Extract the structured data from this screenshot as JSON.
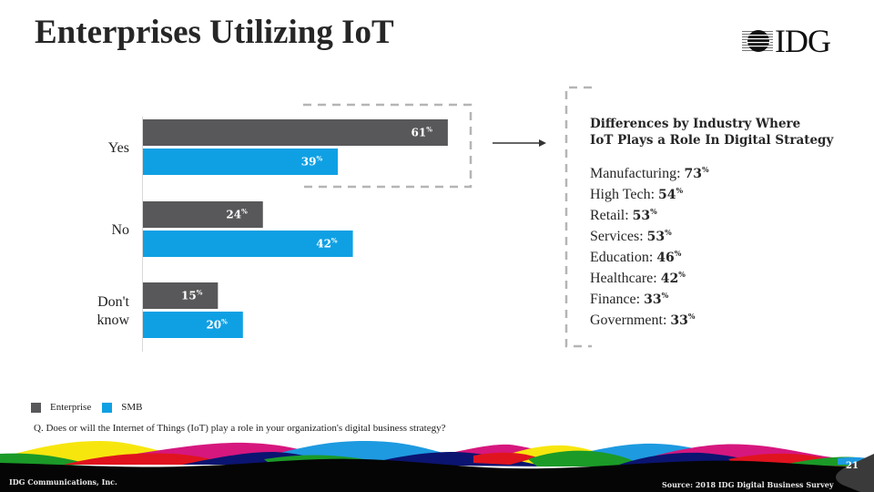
{
  "slide": {
    "title": "Enterprises Utilizing IoT",
    "logo_text": "IDG",
    "question": "Q. Does or will the Internet of Things (IoT) play a  role in your organization's digital business strategy?",
    "footer_left": "IDG Communications, Inc.",
    "footer_right": "Source: 2018 IDG Digital Business Survey",
    "page_number": "21"
  },
  "legend": [
    {
      "label": "Enterprise",
      "color": "#58585a"
    },
    {
      "label": "SMB",
      "color": "#0fa0e4"
    }
  ],
  "chart_data": {
    "type": "bar",
    "orientation": "horizontal",
    "title": "",
    "xlabel": "",
    "ylabel": "",
    "categories": [
      "Yes",
      "No",
      "Don't know"
    ],
    "category_lines": [
      [
        "Yes"
      ],
      [
        "No"
      ],
      [
        "Don't",
        "know"
      ]
    ],
    "series": [
      {
        "name": "Enterprise",
        "color": "#58585a",
        "values": [
          61,
          24,
          15
        ]
      },
      {
        "name": "SMB",
        "color": "#0fa0e4",
        "values": [
          39,
          42,
          20
        ]
      }
    ],
    "unit": "%",
    "xlim": [
      0,
      100
    ],
    "grid": false,
    "legend_position": "bottom-left",
    "highlight": "Yes"
  },
  "industry_panel": {
    "title_line1": "Differences by Industry Where",
    "title_line2": "IoT Plays a Role In Digital Strategy",
    "unit": "%",
    "items": [
      {
        "label": "Manufacturing:",
        "value": "73"
      },
      {
        "label": "High Tech:",
        "value": "54"
      },
      {
        "label": "Retail:",
        "value": "53"
      },
      {
        "label": "Services:",
        "value": "53"
      },
      {
        "label": "Education:",
        "value": "46"
      },
      {
        "label": "Healthcare:",
        "value": "42"
      },
      {
        "label": "Finance:",
        "value": "33"
      },
      {
        "label": "Government:",
        "value": "33"
      }
    ]
  },
  "colors": {
    "enterprise": "#58585a",
    "smb": "#0fa0e4",
    "wave_yellow": "#f7e60e",
    "wave_magenta": "#d6177e",
    "wave_red": "#e0141e",
    "wave_green": "#1b9a28",
    "wave_blue": "#1e9ae0",
    "wave_navy": "#0b1470",
    "footer": "#050505"
  }
}
